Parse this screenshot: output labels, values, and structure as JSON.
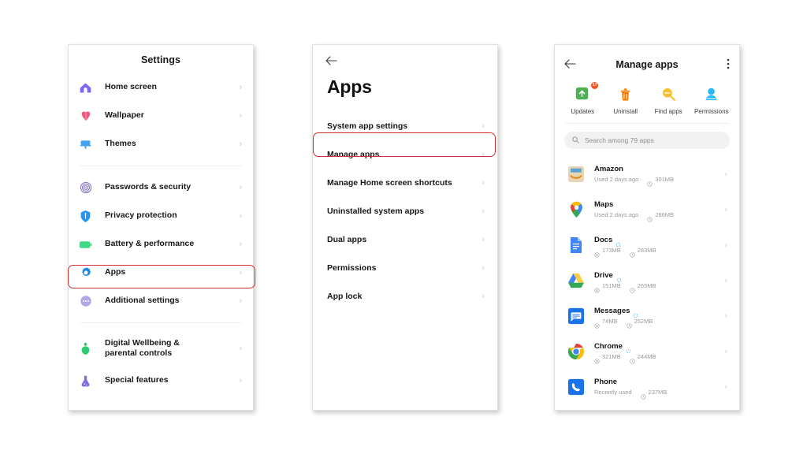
{
  "colors": {
    "highlight": "#d32f2f",
    "home_screen": "#7b68ee",
    "wallpaper": "#f05a7e",
    "themes": "#42a5f5",
    "passwords": "#8e7cc3",
    "privacy": "#2196f3",
    "battery": "#3ddc84",
    "apps": "#1e88e5",
    "additional": "#b0a8e8",
    "wellbeing": "#2ecc71",
    "special": "#7e6ce0",
    "updates": "#4caf50",
    "uninstall": "#f57c00",
    "find_apps": "#fbc02d",
    "permissions": "#29b6f6"
  },
  "panel1": {
    "title": "Settings",
    "groups": [
      {
        "items": [
          {
            "label": "Home screen",
            "icon": "home-icon",
            "color_key": "home_screen"
          },
          {
            "label": "Wallpaper",
            "icon": "wallpaper-flower-icon",
            "color_key": "wallpaper"
          },
          {
            "label": "Themes",
            "icon": "themes-paint-icon",
            "color_key": "themes"
          }
        ]
      },
      {
        "items": [
          {
            "label": "Passwords & security",
            "icon": "fingerprint-icon",
            "color_key": "passwords"
          },
          {
            "label": "Privacy protection",
            "icon": "shield-icon",
            "color_key": "privacy"
          },
          {
            "label": "Battery & performance",
            "icon": "battery-icon",
            "color_key": "battery"
          },
          {
            "label": "Apps",
            "icon": "gear-icon",
            "color_key": "apps"
          },
          {
            "label": "Additional settings",
            "icon": "ellipsis-circle-icon",
            "color_key": "additional"
          }
        ]
      },
      {
        "items": [
          {
            "label": "Digital Wellbeing & parental controls",
            "icon": "wellbeing-icon",
            "color_key": "wellbeing"
          },
          {
            "label": "Special features",
            "icon": "flask-icon",
            "color_key": "special"
          }
        ]
      }
    ],
    "chevron": "›",
    "highlighted_item": "Apps"
  },
  "panel2": {
    "back_icon": "back-arrow-icon",
    "heading": "Apps",
    "items": [
      {
        "label": "System app settings"
      },
      {
        "label": "Manage apps"
      },
      {
        "label": "Manage Home screen shortcuts"
      },
      {
        "label": "Uninstalled system apps"
      },
      {
        "label": "Dual apps"
      },
      {
        "label": "Permissions"
      },
      {
        "label": "App lock"
      }
    ],
    "chevron": "›",
    "highlighted_item": "Manage apps"
  },
  "panel3": {
    "back_icon": "back-arrow-icon",
    "title": "Manage apps",
    "kebab_icon": "overflow-menu-icon",
    "tools": [
      {
        "label": "Updates",
        "icon": "update-arrow-icon",
        "color_key": "updates",
        "badge": "17"
      },
      {
        "label": "Uninstall",
        "icon": "trash-icon",
        "color_key": "uninstall",
        "badge": ""
      },
      {
        "label": "Find apps",
        "icon": "magnifier-minus-icon",
        "color_key": "find_apps",
        "badge": ""
      },
      {
        "label": "Permissions",
        "icon": "person-icon",
        "color_key": "permissions",
        "badge": ""
      }
    ],
    "search": {
      "placeholder": "Search among 79 apps",
      "icon": "search-icon"
    },
    "chevron": "›",
    "apps": [
      {
        "name": "Amazon",
        "sync": false,
        "meta1": "Used 2 days ago",
        "meta1_icon": "",
        "meta2": "301MB",
        "meta2_icon": "clock-icon",
        "icon": "amazon-icon"
      },
      {
        "name": "Maps",
        "sync": false,
        "meta1": "Used 2 days ago",
        "meta1_icon": "",
        "meta2": "286MB",
        "meta2_icon": "clock-icon",
        "icon": "maps-pin-icon"
      },
      {
        "name": "Docs",
        "sync": true,
        "meta1": "173MB",
        "meta1_icon": "storage-icon",
        "meta2": "283MB",
        "meta2_icon": "clock-icon",
        "icon": "docs-icon"
      },
      {
        "name": "Drive",
        "sync": true,
        "meta1": "151MB",
        "meta1_icon": "storage-icon",
        "meta2": "265MB",
        "meta2_icon": "clock-icon",
        "icon": "drive-icon"
      },
      {
        "name": "Messages",
        "sync": true,
        "meta1": "74MB",
        "meta1_icon": "storage-icon",
        "meta2": "252MB",
        "meta2_icon": "clock-icon",
        "icon": "messages-icon"
      },
      {
        "name": "Chrome",
        "sync": true,
        "meta1": "321MB",
        "meta1_icon": "storage-icon",
        "meta2": "244MB",
        "meta2_icon": "clock-icon",
        "icon": "chrome-icon"
      },
      {
        "name": "Phone",
        "sync": false,
        "meta1": "Recently used",
        "meta1_icon": "",
        "meta2": "237MB",
        "meta2_icon": "clock-icon",
        "icon": "phone-icon"
      }
    ]
  }
}
